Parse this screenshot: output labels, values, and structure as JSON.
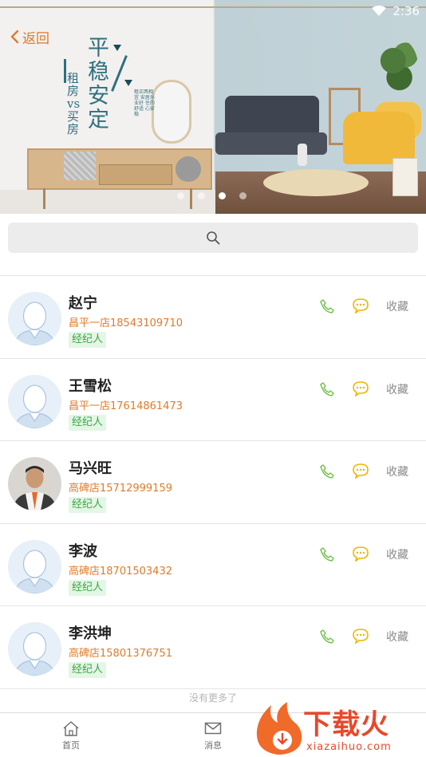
{
  "status_bar": {
    "time": "2:36",
    "wifi_icon": "wifi-icon"
  },
  "header": {
    "back_label": "返回",
    "back_icon": "chevron-left-icon"
  },
  "banner": {
    "headline": "平稳安定",
    "subheadline": "租房vs买房",
    "fine_print": "租买两相宜 安居乐业好 住的舒适 心安稳",
    "carousel": {
      "count": 4,
      "active_index": 2
    }
  },
  "search": {
    "icon": "search-icon"
  },
  "agents": [
    {
      "name": "赵宁",
      "store": "昌平一店18543109710",
      "badge": "经纪人",
      "avatar": "default-avatar",
      "fav_label": "收藏"
    },
    {
      "name": "王雪松",
      "store": "昌平一店17614861473",
      "badge": "经纪人",
      "avatar": "default-avatar",
      "fav_label": "收藏"
    },
    {
      "name": "马兴旺",
      "store": "高碑店15712999159",
      "badge": "经纪人",
      "avatar": "photo-avatar",
      "fav_label": "收藏"
    },
    {
      "name": "李波",
      "store": "高碑店18701503432",
      "badge": "经纪人",
      "avatar": "default-avatar",
      "fav_label": "收藏"
    },
    {
      "name": "李洪坤",
      "store": "高碑店15801376751",
      "badge": "经纪人",
      "avatar": "default-avatar",
      "fav_label": "收藏"
    }
  ],
  "list_footer": "没有更多了",
  "tabbar": [
    {
      "label": "首页",
      "icon": "home-icon"
    },
    {
      "label": "消息",
      "icon": "mail-icon"
    },
    {
      "label": "",
      "icon": ""
    }
  ],
  "watermark": {
    "brand": "下载火",
    "url": "xiazaihuo.com"
  },
  "colors": {
    "accent": "#e07b2a",
    "badge_bg": "#e4f6e5",
    "badge_text": "#3aa545",
    "phone": "#6fbf4a",
    "chat": "#f0b400"
  }
}
